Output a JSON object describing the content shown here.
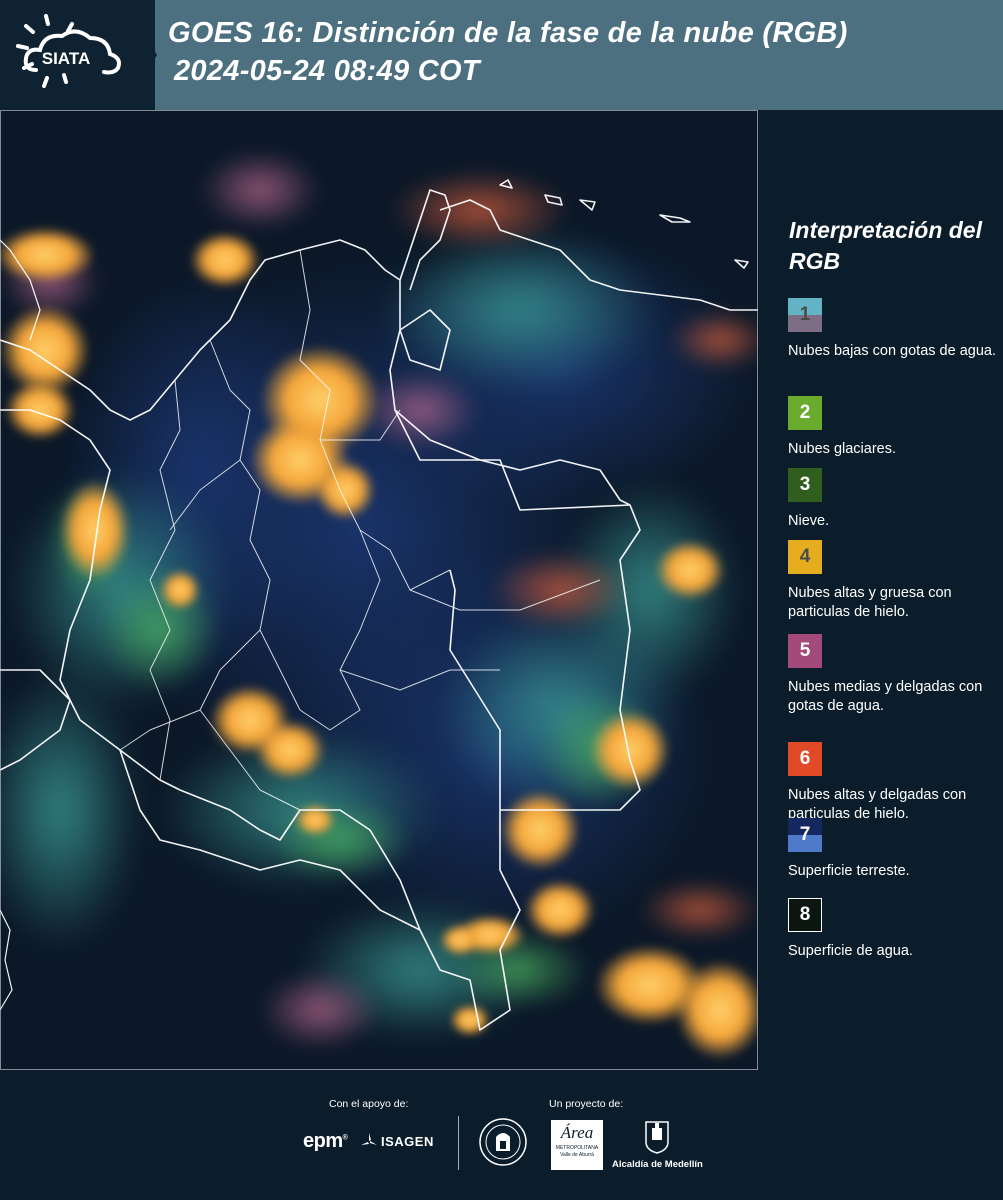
{
  "header": {
    "logo_text": "SIATA",
    "title_line1": "GOES 16: Distinción de la fase de la nube (RGB)",
    "title_line2": "2024-05-24 08:49 COT"
  },
  "legend": {
    "title": "Interpretación del RGB",
    "items": [
      {
        "number": "1",
        "description": "Nubes bajas con gotas de agua.",
        "colors": [
          "#62b3c4",
          "#7c6d85"
        ],
        "text_color": "#4a4a4a"
      },
      {
        "number": "2",
        "description": "Nubes glaciares.",
        "colors": [
          "#6aaa2c"
        ],
        "text_color": "#ffffff"
      },
      {
        "number": "3",
        "description": "Nieve.",
        "colors": [
          "#2f5e1e"
        ],
        "text_color": "#ffffff"
      },
      {
        "number": "4",
        "description": "Nubes altas y gruesa con particulas de hielo.",
        "colors": [
          "#e6ad1f"
        ],
        "text_color": "#4a4a4a"
      },
      {
        "number": "5",
        "description": "Nubes medias y delgadas con gotas de agua.",
        "colors": [
          "#a34a7a"
        ],
        "text_color": "#ffffff"
      },
      {
        "number": "6",
        "description": "Nubes altas y delgadas con particulas de hielo.",
        "colors": [
          "#e04a26"
        ],
        "text_color": "#ffffff"
      },
      {
        "number": "7",
        "description": "Superficie terreste.",
        "colors": [
          "#14275e",
          "#4f79c9"
        ],
        "text_color": "#ffffff"
      },
      {
        "number": "8",
        "description": "Superficie de agua.",
        "colors": [
          "#0b1610"
        ],
        "text_color": "#ffffff"
      }
    ]
  },
  "footer": {
    "support_label": "Con el apoyo de:",
    "project_label": "Un proyecto de:",
    "logos": {
      "epm": "epm",
      "isagen": "ISAGEN",
      "area": "Área",
      "area_sub": "METROPOLITANA",
      "area_sub2": "Valle de Aburrá",
      "alcaldia": "Alcaldía de Medellín"
    }
  }
}
